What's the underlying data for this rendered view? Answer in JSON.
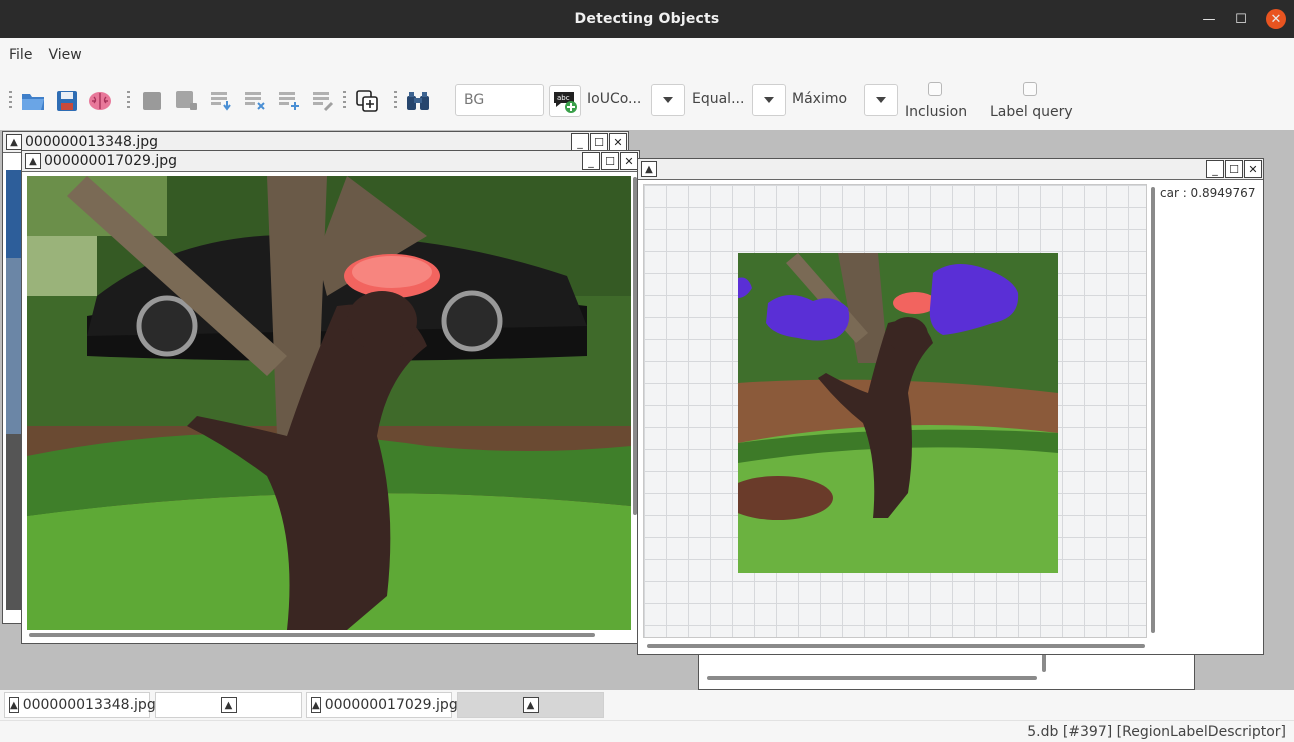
{
  "window": {
    "title": "Detecting Objects"
  },
  "menu": {
    "items": [
      "File",
      "View"
    ]
  },
  "toolbar": {
    "search_value": "BG",
    "combo1_label": "IoUCo...",
    "combo2_label": "Equal...",
    "combo3_label": "Máximo",
    "checkbox1_label": "Inclusion",
    "checkbox2_label": "Label query",
    "icons": [
      "open-folder-icon",
      "save-icon",
      "brain-icon",
      "stop-icon",
      "add-region-icon",
      "download-region-icon",
      "delete-region-icon",
      "add-label-icon",
      "edit-label-icon",
      "copy-add-icon",
      "binoculars-icon",
      "add-text-label-icon"
    ]
  },
  "frames": {
    "back": {
      "title": "000000013348.jpg"
    },
    "front": {
      "title": "000000017029.jpg"
    },
    "result": {
      "title": "",
      "label_text": "car : 0.8949767"
    }
  },
  "taskbar": {
    "items": [
      "000000013348.jpg",
      "",
      "000000017029.jpg",
      ""
    ]
  },
  "status": {
    "text": "5.db [#397] [RegionLabelDescriptor]"
  },
  "colors": {
    "mask": "#5a2fd6",
    "frisbee": "#f2645f",
    "titlebar": "#2b2b2b",
    "close": "#e95420"
  }
}
